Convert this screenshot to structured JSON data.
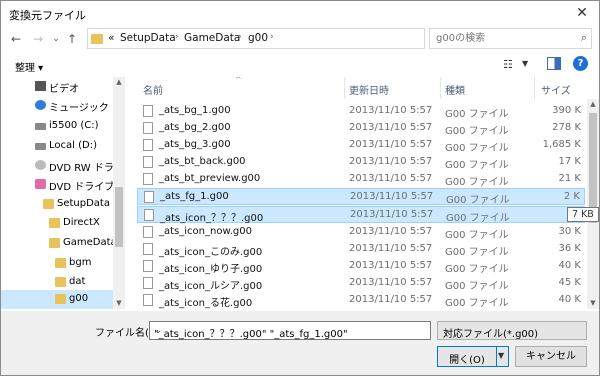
{
  "window": {
    "title": "変換元ファイル",
    "close": "✕"
  },
  "nav": {
    "back": "←",
    "forward": "→",
    "dropdown": "⌄",
    "up": "↑",
    "address_overflow": "«",
    "address_segments": [
      "SetupData",
      "GameData",
      "g00"
    ],
    "address_sep": "›",
    "refresh": "↻",
    "search_placeholder": "g00の検索"
  },
  "toolbar": {
    "organize": "整理 ▾"
  },
  "sidebar": {
    "items": [
      {
        "label": "ビデオ",
        "icon": "video-icon"
      },
      {
        "label": "ミュージック",
        "icon": "music-icon"
      },
      {
        "label": "i5500 (C:)",
        "icon": "drive-icon"
      },
      {
        "label": "Local (D:)",
        "icon": "drive-icon"
      },
      {
        "label": "DVD RW ドライ",
        "icon": "dvd-icon"
      },
      {
        "label": "DVD ドライブ (F",
        "icon": "dvd-pink-icon"
      },
      {
        "label": "SetupData",
        "icon": "folder-icon"
      },
      {
        "label": "DirectX",
        "icon": "folder-icon"
      },
      {
        "label": "GameData",
        "icon": "folder-icon"
      },
      {
        "label": "bgm",
        "icon": "folder-icon"
      },
      {
        "label": "dat",
        "icon": "folder-icon"
      },
      {
        "label": "g00",
        "icon": "folder-icon"
      }
    ]
  },
  "columns": {
    "name": "名前",
    "date": "更新日時",
    "type": "種類",
    "size": "サイズ",
    "sort_indicator": "^"
  },
  "files": [
    {
      "name": "_ats_bg_1.g00",
      "date": "2013/11/10 5:57",
      "type": "G00 ファイル",
      "size": "390 K"
    },
    {
      "name": "_ats_bg_2.g00",
      "date": "2013/11/10 5:57",
      "type": "G00 ファイル",
      "size": "278 K"
    },
    {
      "name": "_ats_bg_3.g00",
      "date": "2013/11/10 5:57",
      "type": "G00 ファイル",
      "size": "1,685 K"
    },
    {
      "name": "_ats_bt_back.g00",
      "date": "2013/11/10 5:57",
      "type": "G00 ファイル",
      "size": "17 K"
    },
    {
      "name": "_ats_bt_preview.g00",
      "date": "2013/11/10 5:57",
      "type": "G00 ファイル",
      "size": "21 K"
    },
    {
      "name": "_ats_fg_1.g00",
      "date": "2013/11/10 5:57",
      "type": "G00 ファイル",
      "size": "2 K"
    },
    {
      "name": "_ats_icon_？？？.g00",
      "date": "2013/11/10 5:57",
      "type": "G00 ファイル",
      "size": ""
    },
    {
      "name": "_ats_icon_now.g00",
      "date": "2013/11/10 5:57",
      "type": "G00 ファイル",
      "size": "30 K"
    },
    {
      "name": "_ats_icon_このみ.g00",
      "date": "2013/11/10 5:57",
      "type": "G00 ファイル",
      "size": "36 K"
    },
    {
      "name": "_ats_icon_ゆり子.g00",
      "date": "2013/11/10 5:57",
      "type": "G00 ファイル",
      "size": "40 K"
    },
    {
      "name": "_ats_icon_ルシア.g00",
      "date": "2013/11/10 5:57",
      "type": "G00 ファイル",
      "size": "45 K"
    },
    {
      "name": "_ats_icon_る花.g00",
      "date": "2013/11/10 5:57",
      "type": "G00 ファイル",
      "size": "40 K"
    }
  ],
  "tooltip": "7 KB",
  "bottom": {
    "filename_label": "ファイル名(N):",
    "filename_value": "\"_ats_icon_？？？.g00\" \"_ats_fg_1.g00\"",
    "filetype": "対応ファイル(*.g00)",
    "open": "開く(O)",
    "cancel": "キャンセル"
  },
  "colors": {
    "selection": "#cce8ff",
    "accent": "#0078d7"
  }
}
